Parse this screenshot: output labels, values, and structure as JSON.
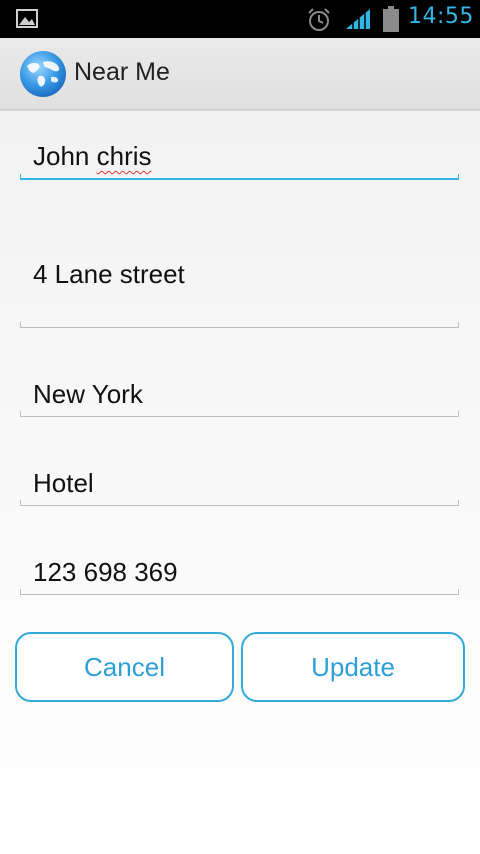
{
  "status_bar": {
    "time": "14:55",
    "icons": [
      "image-notification-icon",
      "alarm-icon",
      "signal-icon",
      "battery-icon"
    ],
    "accent_color": "#33b5e5"
  },
  "action_bar": {
    "app_icon": "globe-icon",
    "title": "Near Me"
  },
  "form": {
    "name": {
      "value": "John chris",
      "value_correct": "John ",
      "value_misspelled": "chris"
    },
    "street": {
      "value": "4 Lane street"
    },
    "city": {
      "value": "New York"
    },
    "category": {
      "value": "Hotel"
    },
    "phone": {
      "value": "123 698 369"
    }
  },
  "buttons": {
    "cancel_label": "Cancel",
    "update_label": "Update",
    "color": "#33a9da"
  }
}
